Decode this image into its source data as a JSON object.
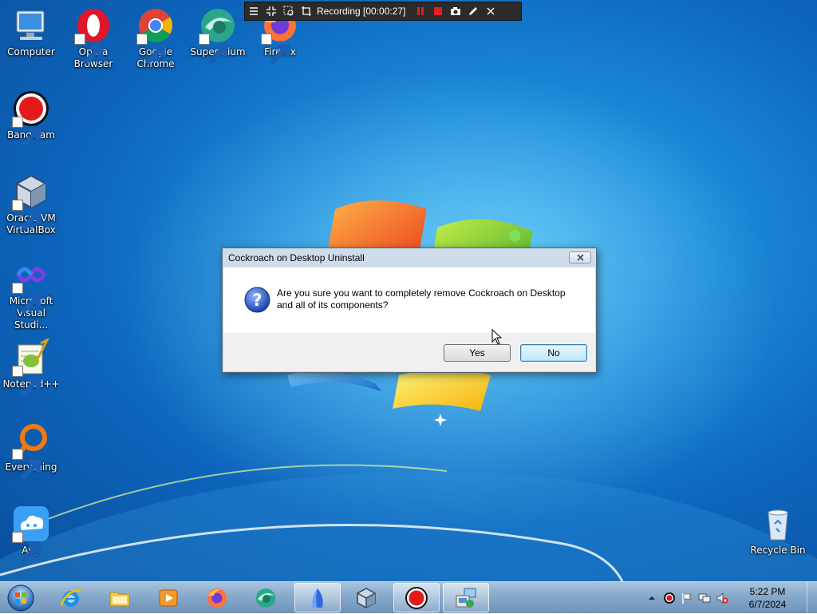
{
  "desktop_icons": [
    {
      "label": "Computer"
    },
    {
      "label": "Opera Browser"
    },
    {
      "label": "Google Chrome"
    },
    {
      "label": "Supermium"
    },
    {
      "label": "Firefox"
    },
    {
      "label": "Bandicam"
    },
    {
      "label": "Oracle VM VirtualBox"
    },
    {
      "label": "Microsoft Visual Studi..."
    },
    {
      "label": "Notepad++"
    },
    {
      "label": "Everything"
    },
    {
      "label": "Airy"
    },
    {
      "label": "Recycle Bin"
    }
  ],
  "recording_bar": {
    "status_text": "Recording [00:00:27]",
    "icons": [
      "menu-icon",
      "shrink-icon",
      "region-icon",
      "crop-icon",
      "pause-icon",
      "stop-icon",
      "camera-icon",
      "pen-icon",
      "close-icon"
    ],
    "accent_color": "#e02020"
  },
  "dialog": {
    "title": "Cockroach on Desktop Uninstall",
    "message_line1": "Are you sure you want to completely remove Cockroach on Desktop",
    "message_line2": "and all of its components?",
    "yes_label": "Yes",
    "no_label": "No",
    "icon": "question-icon"
  },
  "taskbar": {
    "pinned": [
      "start-orb-icon",
      "internet-explorer-icon",
      "file-explorer-icon",
      "media-player-icon",
      "firefox-icon",
      "supermium-icon",
      "installer-icon",
      "virtualbox-icon",
      "bandicam-icon",
      "uninstaller-icon"
    ],
    "clock_time": "5:22 PM",
    "clock_date": "6/7/2024"
  }
}
